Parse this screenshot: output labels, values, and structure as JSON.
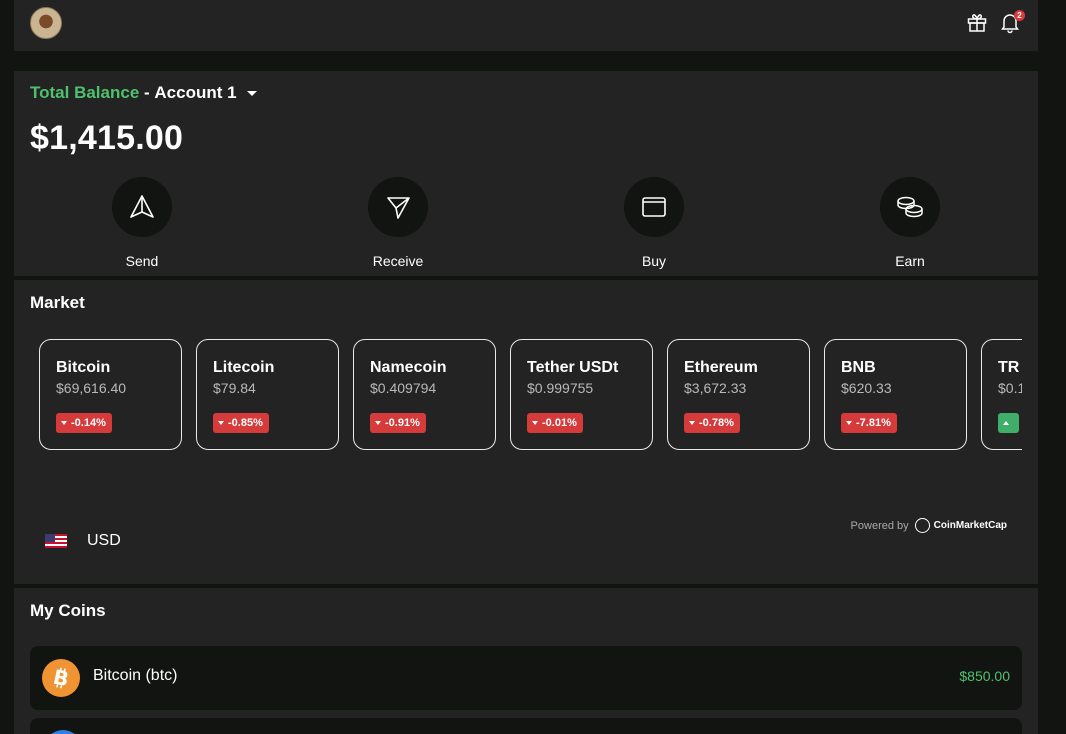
{
  "header": {
    "notifications_count": "2",
    "icons": [
      "avatar",
      "gift-icon",
      "bell-icon"
    ]
  },
  "balance": {
    "label": "Total Balance",
    "separator": " - ",
    "account": "Account 1",
    "amount": "$1,415.00",
    "actions": [
      {
        "label": "Send",
        "icon": "send-icon"
      },
      {
        "label": "Receive",
        "icon": "receive-icon"
      },
      {
        "label": "Buy",
        "icon": "wallet-icon"
      },
      {
        "label": "Earn",
        "icon": "coins-icon"
      }
    ]
  },
  "market": {
    "title": "Market",
    "cards": [
      {
        "name": "Bitcoin",
        "price": "$69,616.40",
        "change": "-0.14%",
        "direction": "down"
      },
      {
        "name": "Litecoin",
        "price": "$79.84",
        "change": "-0.85%",
        "direction": "down"
      },
      {
        "name": "Namecoin",
        "price": "$0.409794",
        "change": "-0.91%",
        "direction": "down"
      },
      {
        "name": "Tether USDt",
        "price": "$0.999755",
        "change": "-0.01%",
        "direction": "down"
      },
      {
        "name": "Ethereum",
        "price": "$3,672.33",
        "change": "-0.78%",
        "direction": "down"
      },
      {
        "name": "BNB",
        "price": "$620.33",
        "change": "-7.81%",
        "direction": "down"
      },
      {
        "name": "TR",
        "price": "$0.1",
        "change": "",
        "direction": "up"
      }
    ],
    "powered_by": "Powered by",
    "powered_brand": "CoinMarketCap",
    "currency": "USD"
  },
  "my_coins": {
    "title": "My Coins",
    "items": [
      {
        "name": "Bitcoin (btc)",
        "value": "$850.00",
        "icon": "bitcoin-icon"
      }
    ]
  },
  "colors": {
    "accent_green": "#4fc16d",
    "negative_red": "#d63b3b",
    "positive_green": "#3fae6a",
    "bitcoin_orange": "#f09433"
  }
}
